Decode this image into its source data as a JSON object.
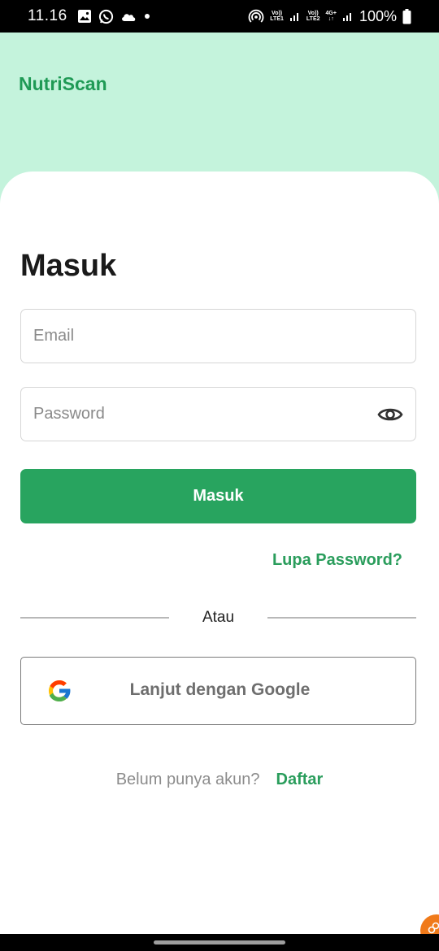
{
  "status_bar": {
    "time": "11.16",
    "battery": "100%",
    "left_icons": [
      "gallery-icon",
      "whatsapp-icon",
      "cloud-icon",
      "dot-icon"
    ],
    "right_icons": [
      "hotspot-icon",
      "volte-lte1-icon",
      "signal-icon",
      "volte-lte2-icon",
      "4g-icon",
      "signal-icon",
      "battery-icon"
    ],
    "sim1_top": "Vo))",
    "sim1_bottom": "LTE1",
    "sim2_top": "Vo))",
    "sim2_bottom": "LTE2",
    "network_top": "4G+",
    "network_bottom": "↓↑"
  },
  "header": {
    "brand": "NutriScan"
  },
  "login": {
    "title": "Masuk",
    "email_placeholder": "Email",
    "email_value": "",
    "password_placeholder": "Password",
    "password_value": "",
    "submit_label": "Masuk",
    "forgot_label": "Lupa Password?",
    "divider_label": "Atau",
    "google_label": "Lanjut dengan Google",
    "signup_prompt": "Belum punya akun?",
    "signup_link": "Daftar"
  },
  "colors": {
    "header_bg": "#c4f3dc",
    "brand": "#1f9a55",
    "primary_button": "#28a45f",
    "link": "#2a9d5c"
  }
}
